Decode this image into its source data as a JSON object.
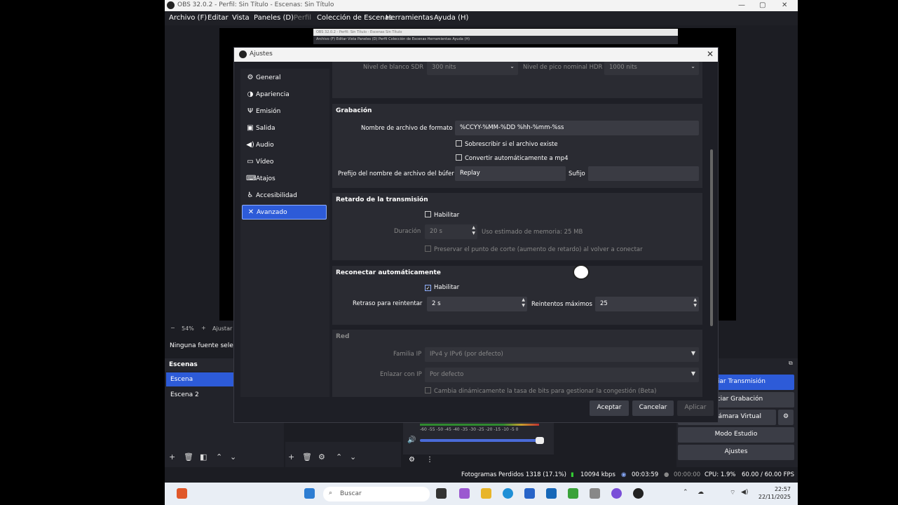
{
  "obs": {
    "title": "OBS 32.0.2 - Perfil: Sin Título - Escenas: Sin Título",
    "menu": [
      "Archivo (F)",
      "Editar",
      "Vista",
      "Paneles (D)",
      "Perfil",
      "Colección de Escenas",
      "Herramientas",
      "Ayuda (H)"
    ],
    "inner_title": "OBS 32.0.2 - Perfil: Sin Título - Escenas Sin Título",
    "inner_menu": "Archivo (F)   Editar   Vista   Paneles (D)   Perfil   Colección de Escenas   Herramientas   Ayuda (H)",
    "zoom": "54%",
    "zoom_adjust": "Ajustar a",
    "no_source": "Ninguna fuente seleccionada",
    "scenes": {
      "header": "Escenas",
      "items": [
        "Escena",
        "Escena 2"
      ]
    },
    "meter_ticks": "-60 -55 -50 -45 -40 -35 -30 -25 -20 -15 -10 -5 0",
    "controls": [
      "Iniciar Transmisión",
      "Iniciar Grabación",
      "Iniciar Cámara Virtual",
      "Modo Estudio",
      "Ajustes"
    ],
    "status": {
      "dropped": "Fotogramas Perdidos 1318 (17.1%)",
      "bitrate": "10094 kbps",
      "stream_time": "00:03:59",
      "rec_time": "00:00:00",
      "cpu": "CPU: 1.9%",
      "fps": "60.00 / 60.00 FPS"
    }
  },
  "dialog": {
    "title": "Ajustes",
    "sidebar": [
      {
        "label": "General",
        "icon": "gear-icon",
        "glyph": "⚙"
      },
      {
        "label": "Apariencia",
        "icon": "palette-icon",
        "glyph": "◑"
      },
      {
        "label": "Emisión",
        "icon": "antenna-icon",
        "glyph": "Ψ"
      },
      {
        "label": "Salida",
        "icon": "output-icon",
        "glyph": "▣"
      },
      {
        "label": "Audio",
        "icon": "speaker-icon",
        "glyph": "◀)"
      },
      {
        "label": "Vídeo",
        "icon": "monitor-icon",
        "glyph": "▭"
      },
      {
        "label": "Atajos",
        "icon": "keyboard-icon",
        "glyph": "⌨"
      },
      {
        "label": "Accesibilidad",
        "icon": "accessibility-icon",
        "glyph": "♿"
      },
      {
        "label": "Avanzado",
        "icon": "tools-icon",
        "glyph": "✕"
      }
    ],
    "hdr": {
      "white_label": "Nivel de blanco SDR",
      "white_value": "300 nits",
      "peak_label": "Nivel de pico nominal HDR",
      "peak_value": "1000 nits"
    },
    "recording": {
      "title": "Grabación",
      "filename_label": "Nombre de archivo de formato",
      "filename_value": "%CCYY-%MM-%DD %hh-%mm-%ss",
      "overwrite": "Sobrescribir si el archivo existe",
      "remux": "Convertir automáticamente a mp4",
      "buffer_prefix_label": "Prefijo del nombre de archivo del búfer",
      "buffer_prefix_value": "Replay",
      "suffix_label": "Sufijo",
      "suffix_value": ""
    },
    "delay": {
      "title": "Retardo de la transmisión",
      "enable": "Habilitar",
      "duration_label": "Duración",
      "duration_value": "20 s",
      "memory_note": "Uso estimado de memoria: 25 MB",
      "preserve": "Preservar el punto de corte (aumento de retardo) al volver a conectar"
    },
    "reconnect": {
      "title": "Reconectar automáticamente",
      "enable": "Habilitar",
      "enabled": true,
      "retry_label": "Retraso para reintentar",
      "retry_value": "2 s",
      "max_label": "Reintentos máximos",
      "max_value": "25"
    },
    "network": {
      "title": "Red",
      "ip_family_label": "Familia IP",
      "ip_family_value": "IPv4 y IPv6 (por defecto)",
      "bind_label": "Enlazar con IP",
      "bind_value": "Por defecto",
      "dynamic": "Cambia dinámicamente la tasa de bits para gestionar la congestión (Beta)"
    },
    "buttons": {
      "accept": "Aceptar",
      "cancel": "Cancelar",
      "apply": "Aplicar"
    }
  },
  "taskbar": {
    "search": "Buscar",
    "time": "22:57",
    "date": "22/11/2025"
  },
  "colors": {
    "accent": "#2d5bd8",
    "panel": "#2a2b32",
    "background": "#1e1f26"
  }
}
